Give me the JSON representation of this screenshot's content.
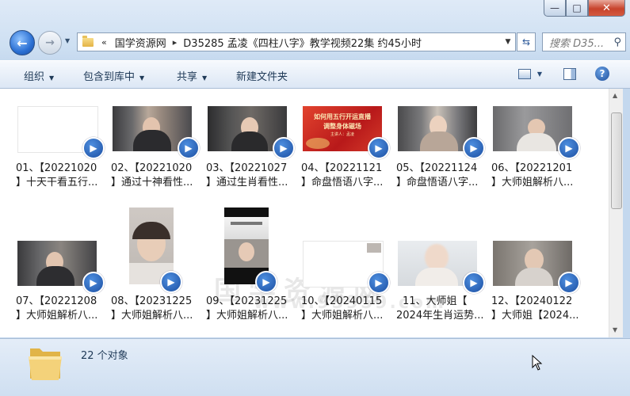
{
  "window": {
    "minimize": "—",
    "maximize": "□",
    "close": "✕"
  },
  "address": {
    "overflow": "«",
    "crumbs": [
      "国学资源网",
      "D35285 孟凌《四柱八字》教学视频22集 约45小时"
    ],
    "separator": "▸"
  },
  "search": {
    "placeholder": "搜索 D35..."
  },
  "toolbar": {
    "organize": "组织",
    "include_library": "包含到库中",
    "share": "共享",
    "new_folder": "新建文件夹"
  },
  "files": [
    {
      "line1": "01、【20221020",
      "line2": "】十天干看五行..."
    },
    {
      "line1": "02、【20221020",
      "line2": "】通过十神看性..."
    },
    {
      "line1": "03、【20221027",
      "line2": "】通过生肖看性..."
    },
    {
      "line1": "04、【20221121",
      "line2": "】命盘悟语八字..."
    },
    {
      "line1": "05、【20221124",
      "line2": "】命盘悟语八字..."
    },
    {
      "line1": "06、【20221201",
      "line2": "】大师姐解析八..."
    },
    {
      "line1": "07、【20221208",
      "line2": "】大师姐解析八..."
    },
    {
      "line1": "08、【20231225",
      "line2": "】大师姐解析八..."
    },
    {
      "line1": "09、【20231225",
      "line2": "】大师姐解析八..."
    },
    {
      "line1": "10、【20240115",
      "line2": "】大师姐解析八..."
    },
    {
      "line1": "11、大师姐【",
      "line2": "2024年生肖运势..."
    },
    {
      "line1": "12、【20240122",
      "line2": "】大师姐【2024..."
    }
  ],
  "thumbnail_texts": {
    "banner_line1": "如何用五行开运直播",
    "banner_line2": "调整身体磁场",
    "banner_line3": "主讲人：孟凌"
  },
  "watermark": {
    "line1": "国学资源网",
    "line2": "www.95959.com"
  },
  "status": {
    "count": "22 个对象"
  },
  "colors": {
    "accent": "#1c4fa2",
    "close_red": "#c7432c",
    "window_frame": "#cddff2"
  }
}
